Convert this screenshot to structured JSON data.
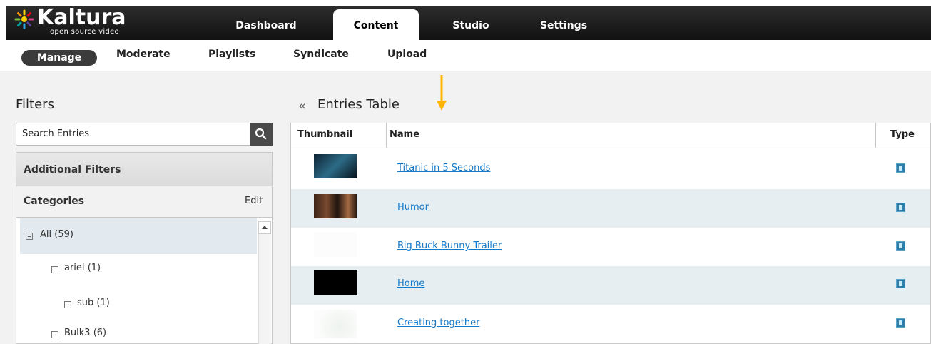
{
  "app": {
    "logo_text": "Kaltura",
    "logo_sub": "open source video"
  },
  "main_nav": [
    {
      "label": "Dashboard",
      "active": false
    },
    {
      "label": "Content",
      "active": true
    },
    {
      "label": "Studio",
      "active": false
    },
    {
      "label": "Settings",
      "active": false
    }
  ],
  "sub_nav": [
    {
      "label": "Manage",
      "active": true
    },
    {
      "label": "Moderate",
      "active": false
    },
    {
      "label": "Playlists",
      "active": false
    },
    {
      "label": "Syndicate",
      "active": false
    },
    {
      "label": "Upload",
      "active": false
    }
  ],
  "filters": {
    "title": "Filters",
    "search_value": "Search Entries",
    "additional_filters": "Additional Filters",
    "categories_label": "Categories",
    "edit_label": "Edit",
    "tree": [
      {
        "label": "All",
        "count": "(59)"
      },
      {
        "label": "ariel",
        "count": "(1)"
      },
      {
        "label": "sub",
        "count": "(1)"
      },
      {
        "label": "Bulk3",
        "count": "(6)"
      }
    ]
  },
  "entries": {
    "collapse_glyph": "«",
    "title": "Entries Table",
    "columns": [
      "Thumbnail",
      "Name",
      "Type"
    ],
    "rows": [
      {
        "name": "Titanic in 5 Seconds"
      },
      {
        "name": "Humor"
      },
      {
        "name": "Big Buck Bunny Trailer"
      },
      {
        "name": "Home"
      },
      {
        "name": "Creating together"
      }
    ]
  },
  "colors": {
    "link": "#1479c9",
    "highlight_arrow": "#ffb400",
    "row_alt": "#e6eef2"
  }
}
